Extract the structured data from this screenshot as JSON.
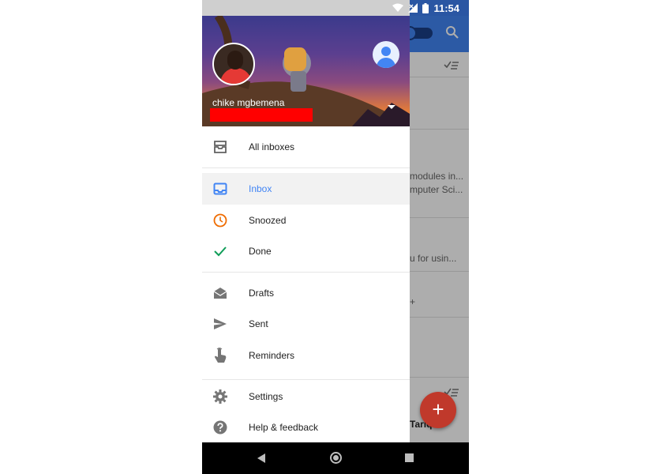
{
  "status_bar": {
    "time": "11:54"
  },
  "account": {
    "name": "chike mgbemena"
  },
  "menu": {
    "all_inboxes": "All inboxes",
    "inbox": "Inbox",
    "snoozed": "Snoozed",
    "done": "Done",
    "drafts": "Drafts",
    "sent": "Sent",
    "reminders": "Reminders",
    "settings": "Settings",
    "help": "Help & feedback"
  },
  "background_list": {
    "row1_line1": "modules in...",
    "row1_line2": "mputer Sci...",
    "row2_line1": "u for usin...",
    "row4_sender": "Tariq...",
    "fab_label": "+"
  },
  "colors": {
    "accent": "#4285f4",
    "snoozed": "#ef6c00",
    "done": "#0f9d58",
    "fab": "#c0392b",
    "email_redaction": "#ff0000"
  }
}
